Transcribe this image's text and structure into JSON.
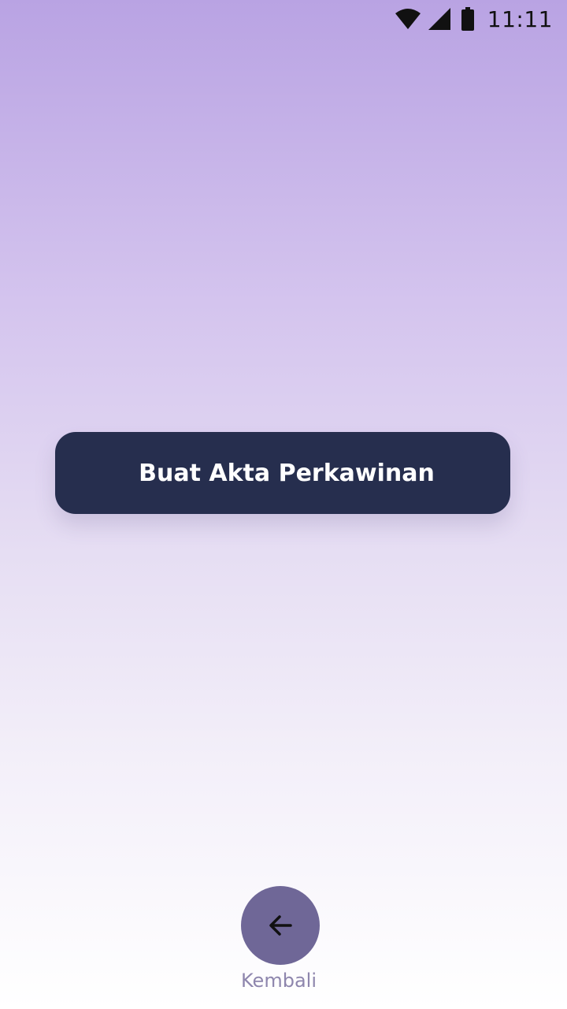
{
  "status_bar": {
    "time": "11:11",
    "icons": [
      "wifi-icon",
      "signal-icon",
      "battery-icon"
    ]
  },
  "main": {
    "create_button_label": "Buat Akta Perkawinan"
  },
  "footer": {
    "back_icon": "arrow-left-icon",
    "back_label": "Kembali"
  },
  "colors": {
    "gradient_top": "#b9a3e3",
    "gradient_bottom": "#ffffff",
    "button_bg": "#262e4e",
    "button_text": "#ffffff",
    "back_button_bg": "#6f6797",
    "back_label_text": "#8e86ad"
  }
}
